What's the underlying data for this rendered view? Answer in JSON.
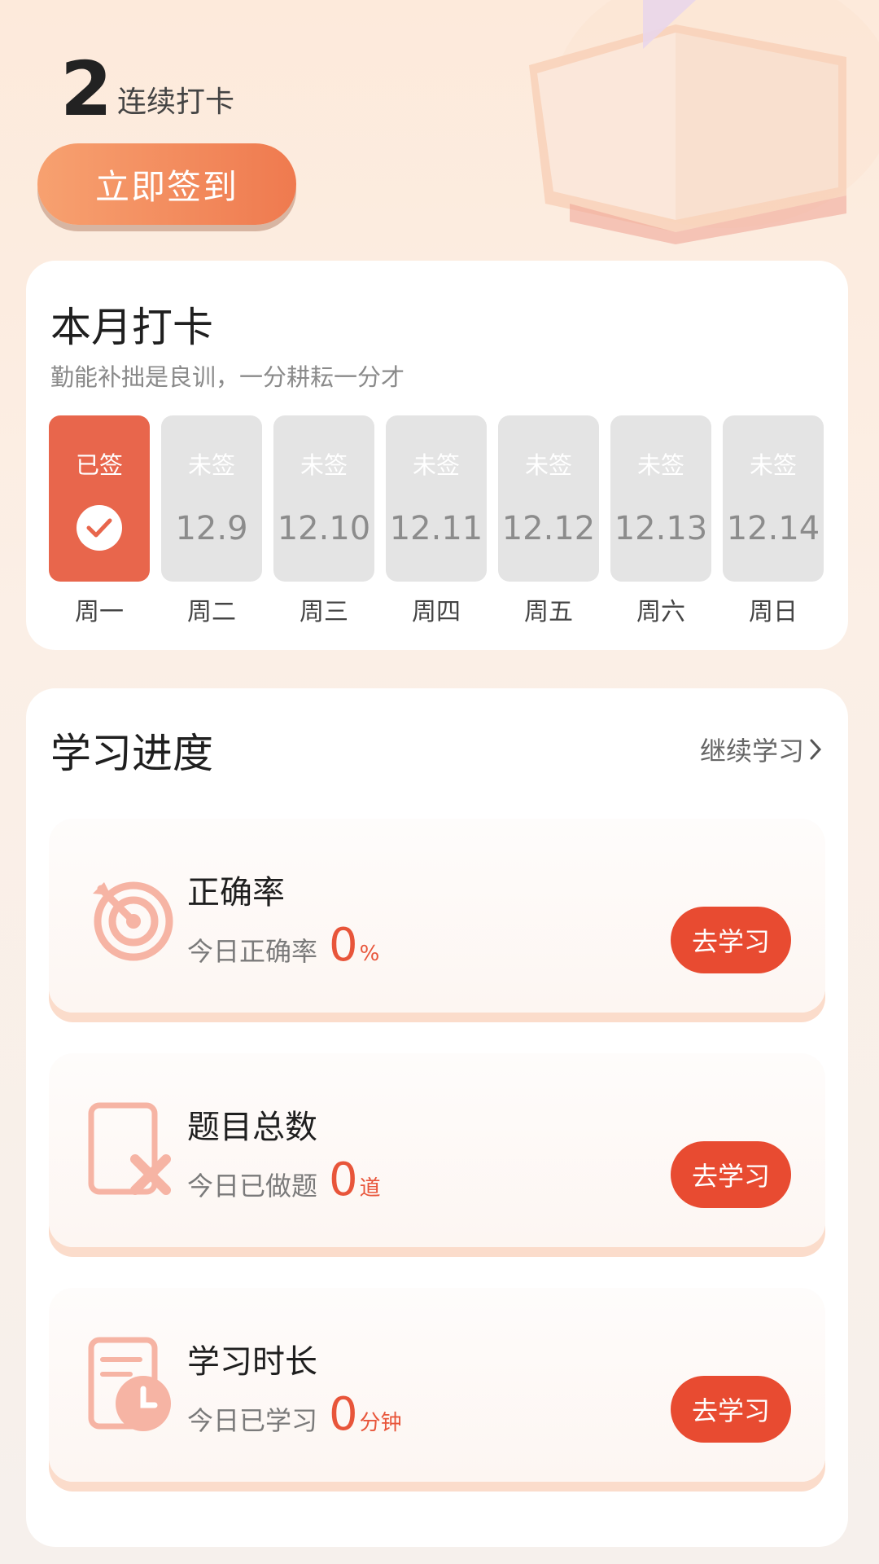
{
  "header": {
    "streak_count": "2",
    "streak_label": "连续打卡",
    "checkin_button": "立即签到"
  },
  "month_card": {
    "title": "本月打卡",
    "subtitle": "勤能补拙是良训，一分耕耘一分才",
    "days": [
      {
        "status": "已签",
        "date": "",
        "weekday": "周一",
        "signed": true
      },
      {
        "status": "未签",
        "date": "12.9",
        "weekday": "周二",
        "signed": false
      },
      {
        "status": "未签",
        "date": "12.10",
        "weekday": "周三",
        "signed": false
      },
      {
        "status": "未签",
        "date": "12.11",
        "weekday": "周四",
        "signed": false
      },
      {
        "status": "未签",
        "date": "12.12",
        "weekday": "周五",
        "signed": false
      },
      {
        "status": "未签",
        "date": "12.13",
        "weekday": "周六",
        "signed": false
      },
      {
        "status": "未签",
        "date": "12.14",
        "weekday": "周日",
        "signed": false
      }
    ]
  },
  "progress_card": {
    "title": "学习进度",
    "continue_link": "继续学习",
    "items": [
      {
        "title": "正确率",
        "label": "今日正确率",
        "value": "0",
        "unit": "%",
        "button": "去学习",
        "icon": "target-icon"
      },
      {
        "title": "题目总数",
        "label": "今日已做题",
        "value": "0",
        "unit": "道",
        "button": "去学习",
        "icon": "document-x-icon"
      },
      {
        "title": "学习时长",
        "label": "今日已学习",
        "value": "0",
        "unit": "分钟",
        "button": "去学习",
        "icon": "document-clock-icon"
      }
    ]
  },
  "colors": {
    "accent": "#e84b31",
    "signed_day": "#e8664c",
    "unsigned_day": "#e4e4e4"
  }
}
